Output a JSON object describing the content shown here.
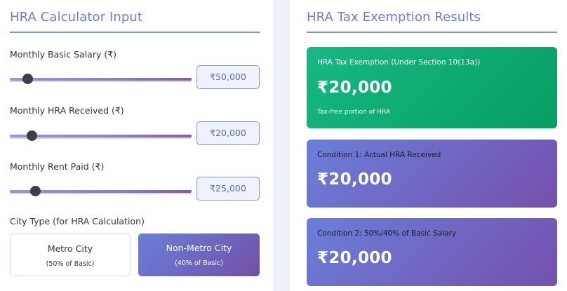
{
  "input_panel": {
    "title": "HRA Calculator Input",
    "fields": [
      {
        "label": "Monthly Basic Salary (₹)",
        "value": "₹50,000",
        "slider_fraction": 0.1
      },
      {
        "label": "Monthly HRA Received (₹)",
        "value": "₹20,000",
        "slider_fraction": 0.12
      },
      {
        "label": "Monthly Rent Paid (₹)",
        "value": "₹25,000",
        "slider_fraction": 0.14
      }
    ],
    "city_type": {
      "heading": "City Type (for HRA Calculation)",
      "options": [
        {
          "name": "Metro City",
          "sub": "(50% of Basic)",
          "selected": false
        },
        {
          "name": "Non-Metro City",
          "sub": "(40% of Basic)",
          "selected": true
        }
      ]
    }
  },
  "results_panel": {
    "title": "HRA Tax Exemption Results",
    "cards": [
      {
        "label": "HRA Tax Exemption (Under Section 10(13a))",
        "amount": "₹20,000",
        "note": "Tax-free portion of HRA"
      },
      {
        "label": "Condition 1: Actual HRA Received",
        "amount": "₹20,000"
      },
      {
        "label": "Condition 2: 50%/40% of Basic Salary",
        "amount": "₹20,000"
      }
    ]
  },
  "colors": {
    "accent": "#6a7fd4",
    "exemption_card": "#0fa872",
    "condition_card_start": "#6a7fd9",
    "condition_card_end": "#7550ad"
  }
}
